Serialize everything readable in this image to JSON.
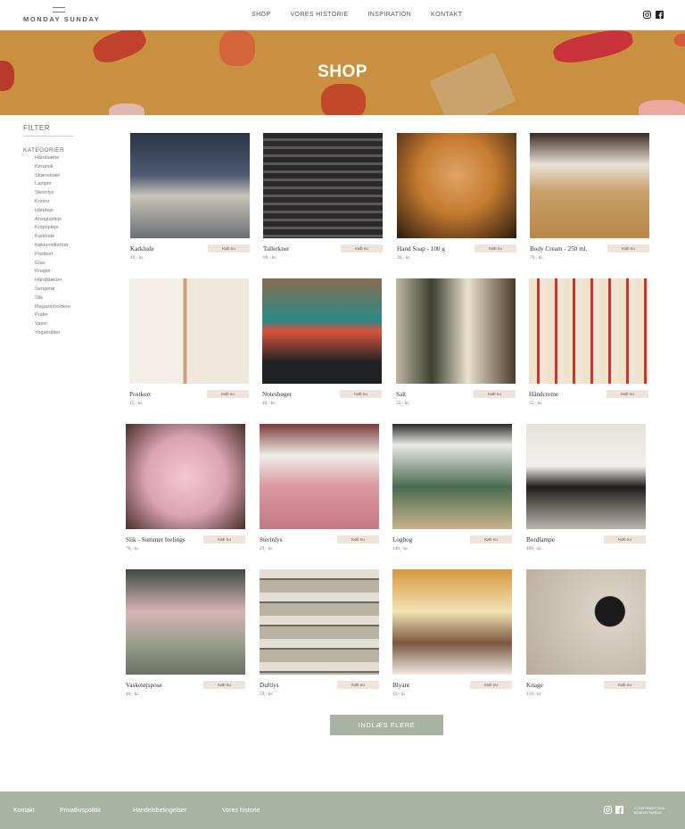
{
  "brand": {
    "name": "MONDAY SUNDAY"
  },
  "nav": {
    "items": [
      "SHOP",
      "VORES HISTORIE",
      "INSPIRATION",
      "KONTAKT"
    ]
  },
  "hero": {
    "title": "SHOP"
  },
  "sidebar": {
    "filter_title": "FILTER",
    "category_title": "KATEGORIER",
    "categories": [
      "Håndsæbe",
      "Keramik",
      "Skærebræt",
      "Lamper",
      "Sterinlys",
      "Kontor",
      "Hårpleje",
      "Ansigtspleje",
      "Kropspleje",
      "Karklude",
      "Køkkentilbehør",
      "Postkort",
      "Glas",
      "Knager",
      "Håndklæder",
      "Sengetøj",
      "Slik",
      "Magasinholdere",
      "Puder",
      "Vaser",
      "Yogamåtter"
    ]
  },
  "buy_label": "Køb nu",
  "products": [
    {
      "name": "Karklude",
      "price": "49,- kr."
    },
    {
      "name": "Tallerkner",
      "price": "99,- kr."
    },
    {
      "name": "Hand Soap - 100 g",
      "price": "39,- kr."
    },
    {
      "name": "Body Cream - 250 ml.",
      "price": "79,- kr."
    },
    {
      "name": "Postkort",
      "price": "15,- kr."
    },
    {
      "name": "Notesbøger",
      "price": "49,- kr."
    },
    {
      "name": "Salt",
      "price": "55,- kr."
    },
    {
      "name": "Håndcreme",
      "price": "55,- kr."
    },
    {
      "name": "Slik - Summer feelings",
      "price": "79,- kr."
    },
    {
      "name": "Sterinlys",
      "price": "29,- kr."
    },
    {
      "name": "Logbog",
      "price": "149,- kr."
    },
    {
      "name": "Bordlampe",
      "price": "499,- kr."
    },
    {
      "name": "Vasketøjspose",
      "price": "49,- kr."
    },
    {
      "name": "Duftlys",
      "price": "59,- kr."
    },
    {
      "name": "Blyant",
      "price": "12,- kr."
    },
    {
      "name": "Knage",
      "price": "119,- kr."
    }
  ],
  "load_more": "INDLÆS FLERE",
  "footer": {
    "links": [
      "Kontakt",
      "Privatlivspolitik",
      "Handelsbetingelser",
      "Vores historie"
    ],
    "copyright": "© COPYRIGHT 2019 MONDAY SUNDAY"
  },
  "icons": [
    "instagram-icon",
    "facebook-icon"
  ],
  "colors": {
    "accent": "#a9b3a4",
    "buy_button": "#efe4dc",
    "hero": "#c9913f"
  }
}
